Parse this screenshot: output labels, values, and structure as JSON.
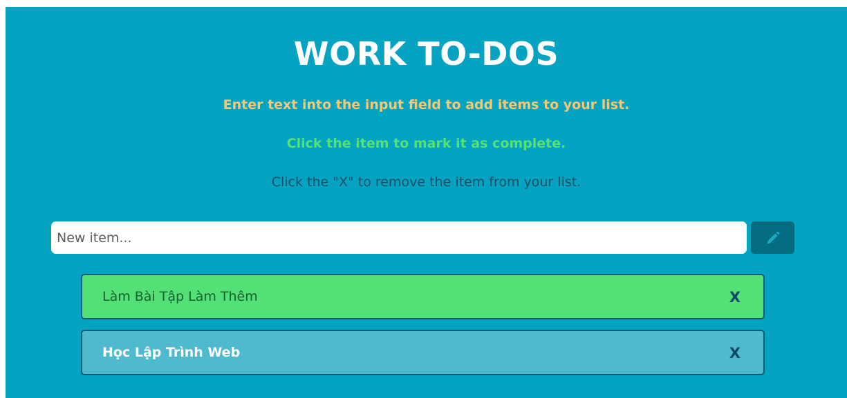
{
  "header": {
    "title": "WORK TO-DOS"
  },
  "instructions": {
    "add": "Enter text into the input field to add items to your list.",
    "complete": "Click the item to mark it as complete.",
    "remove": "Click the \"X\" to remove the item from your list."
  },
  "new_item": {
    "value": "",
    "placeholder": "New item...",
    "add_icon": "pencil-icon"
  },
  "todos": [
    {
      "text": "Làm Bài Tập Làm Thêm",
      "completed": true,
      "remove_label": "X"
    },
    {
      "text": "Học Lập Trình Web",
      "completed": false,
      "remove_label": "X"
    }
  ],
  "colors": {
    "background": "#03a3c1",
    "completed_item": "#52e077",
    "pending_item": "#4fb9cd",
    "add_button": "#046d82",
    "add_instruction": "#f7c774",
    "complete_instruction": "#55e078",
    "remove_instruction": "#1f4e66"
  }
}
